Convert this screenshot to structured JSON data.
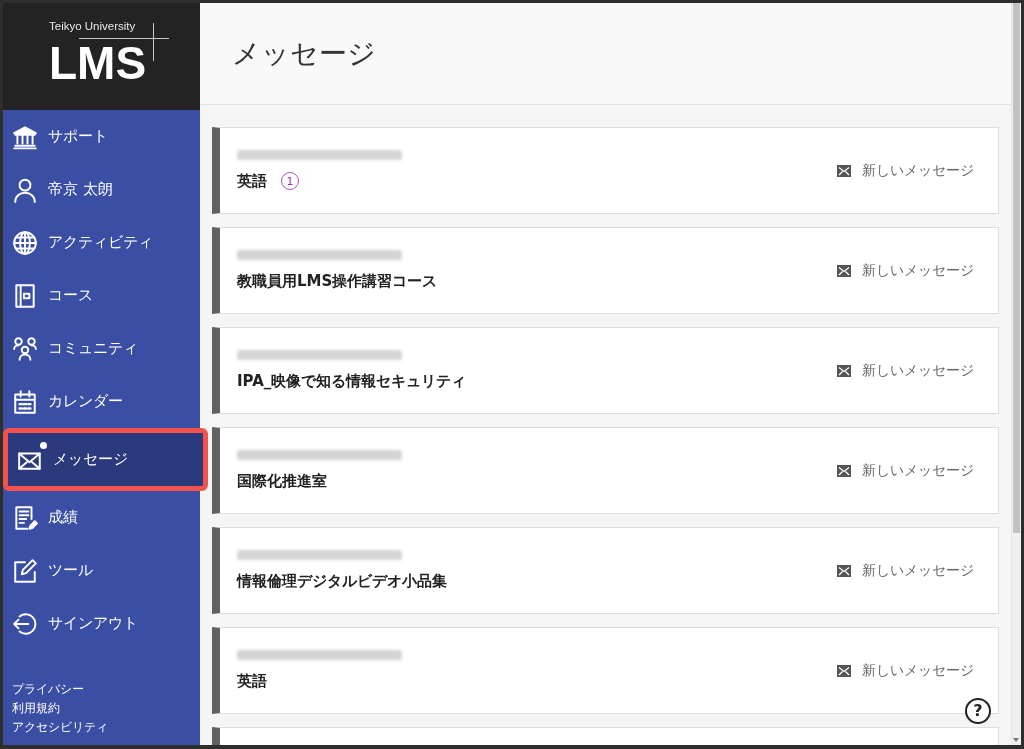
{
  "logo": {
    "university": "Teikyo University",
    "product": "LMS"
  },
  "sidebar": {
    "items": [
      {
        "kind": "support",
        "label": "サポート",
        "selected": false,
        "unread": false
      },
      {
        "kind": "profile",
        "label": "帝京 太朗",
        "selected": false,
        "unread": false
      },
      {
        "kind": "activity",
        "label": "アクティビティ",
        "selected": false,
        "unread": false
      },
      {
        "kind": "courses",
        "label": "コース",
        "selected": false,
        "unread": false
      },
      {
        "kind": "community",
        "label": "コミュニティ",
        "selected": false,
        "unread": false
      },
      {
        "kind": "calendar",
        "label": "カレンダー",
        "selected": false,
        "unread": false
      },
      {
        "kind": "messages",
        "label": "メッセージ",
        "selected": true,
        "unread": true
      },
      {
        "kind": "grades",
        "label": "成績",
        "selected": false,
        "unread": false
      },
      {
        "kind": "tools",
        "label": "ツール",
        "selected": false,
        "unread": false
      },
      {
        "kind": "signout",
        "label": "サインアウト",
        "selected": false,
        "unread": false
      }
    ],
    "footer_links": [
      "プライバシー",
      "利用規約",
      "アクセシビリティ"
    ]
  },
  "page": {
    "title": "メッセージ"
  },
  "courses": [
    {
      "id_redacted": true,
      "name": "英語",
      "unread_count": "1",
      "action": "新しいメッセージ"
    },
    {
      "id_redacted": true,
      "name": "教職員用LMS操作講習コース",
      "action": "新しいメッセージ"
    },
    {
      "id_redacted": true,
      "name": "IPA_映像で知る情報セキュリティ",
      "action": "新しいメッセージ"
    },
    {
      "id_redacted": true,
      "name": "国際化推進室",
      "action": "新しいメッセージ"
    },
    {
      "id_redacted": true,
      "name": "情報倫理デジタルビデオ小品集",
      "action": "新しいメッセージ"
    },
    {
      "id_redacted": true,
      "name": "英語",
      "action": "新しいメッセージ"
    }
  ],
  "courses_more_below": true,
  "help": {
    "glyph": "?"
  }
}
